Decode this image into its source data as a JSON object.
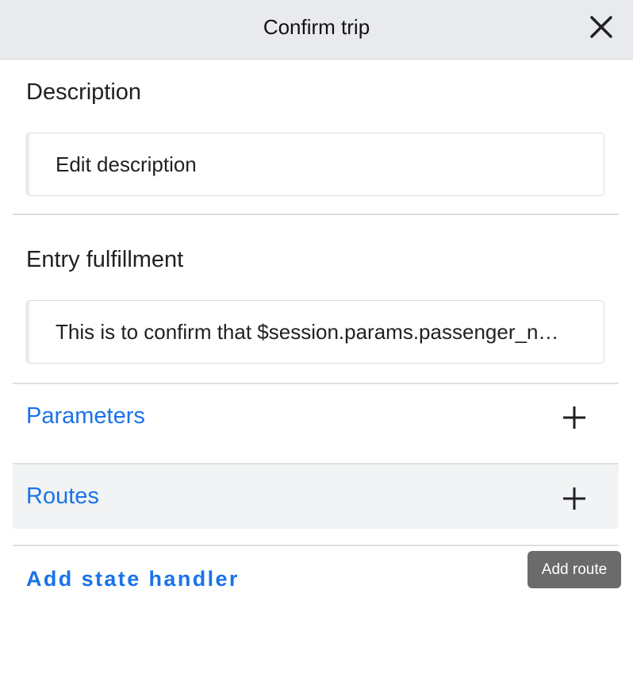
{
  "header": {
    "title": "Confirm trip",
    "close_icon": "close-icon"
  },
  "description": {
    "title": "Description",
    "value": "Edit description"
  },
  "entry_fulfillment": {
    "title": "Entry fulfillment",
    "value": "This is to confirm that $session.params.passenger_name"
  },
  "parameters": {
    "label": "Parameters",
    "add_icon": "plus-icon"
  },
  "routes": {
    "label": "Routes",
    "add_icon": "plus-icon"
  },
  "add_state_handler": {
    "label": "Add state handler"
  },
  "tooltip": {
    "text": "Add route"
  },
  "colors": {
    "accent": "#1a73e8",
    "header_bg": "#e8eaed",
    "tooltip_bg": "#6b6b6b",
    "routes_bg": "#f1f3f4"
  }
}
